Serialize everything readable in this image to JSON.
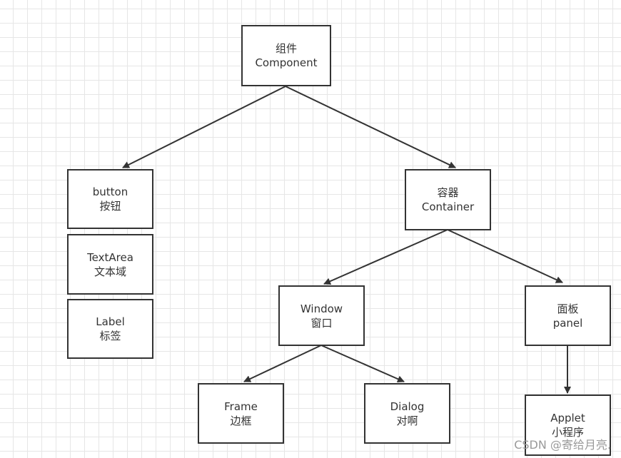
{
  "nodes": {
    "component": {
      "zh": "组件",
      "en": "Component"
    },
    "button": {
      "en": "button",
      "zh": "按钮"
    },
    "textarea": {
      "en": "TextArea",
      "zh": "文本域"
    },
    "label": {
      "en": "Label",
      "zh": "标签"
    },
    "container": {
      "zh": "容器",
      "en": "Container"
    },
    "window": {
      "en": "Window",
      "zh": "窗口"
    },
    "panel": {
      "zh": "面板",
      "en": "panel"
    },
    "frame": {
      "en": "Frame",
      "zh": "边框"
    },
    "dialog": {
      "en": "Dialog",
      "zh": "对啊"
    },
    "applet": {
      "en": "Applet",
      "zh": "小程序"
    }
  },
  "edges": [
    [
      "component",
      "button"
    ],
    [
      "component",
      "container"
    ],
    [
      "container",
      "window"
    ],
    [
      "container",
      "panel"
    ],
    [
      "window",
      "frame"
    ],
    [
      "window",
      "dialog"
    ],
    [
      "panel",
      "applet"
    ]
  ],
  "colors": {
    "line": "#333333",
    "grid": "#e6e6e6"
  },
  "watermark": "CSDN @寄给月亮."
}
